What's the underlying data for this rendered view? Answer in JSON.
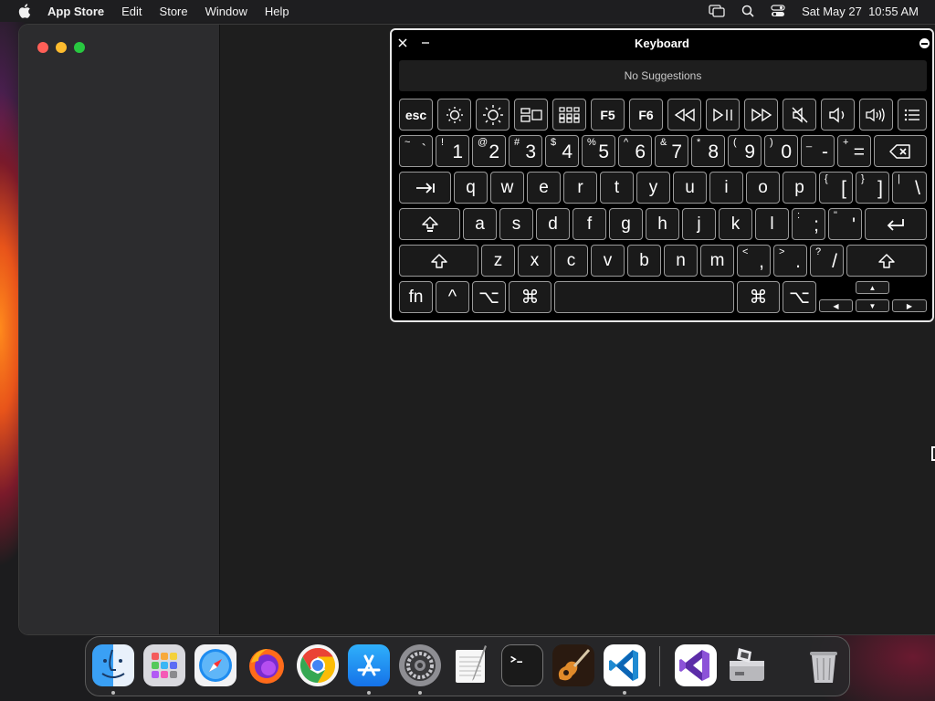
{
  "menubar": {
    "app_name": "App Store",
    "items": [
      "Edit",
      "Store",
      "Window",
      "Help"
    ],
    "datetime": "Sat May 27  10:55 AM"
  },
  "keyboard_viewer": {
    "title": "Keyboard",
    "suggestions": "No Suggestions",
    "function_row": [
      "esc",
      "brightness-down-icon",
      "brightness-up-icon",
      "mission-control-icon",
      "launchpad-icon",
      "F5",
      "F6",
      "rewind-icon",
      "play-pause-icon",
      "fast-forward-icon",
      "mute-icon",
      "volume-down-icon",
      "volume-up-icon",
      "menu-icon"
    ],
    "number_row": [
      {
        "shift": "~",
        "main": "`"
      },
      {
        "shift": "!",
        "main": "1"
      },
      {
        "shift": "@",
        "main": "2"
      },
      {
        "shift": "#",
        "main": "3"
      },
      {
        "shift": "$",
        "main": "4"
      },
      {
        "shift": "%",
        "main": "5"
      },
      {
        "shift": "^",
        "main": "6"
      },
      {
        "shift": "&",
        "main": "7"
      },
      {
        "shift": "*",
        "main": "8"
      },
      {
        "shift": "(",
        "main": "9"
      },
      {
        "shift": ")",
        "main": "0"
      },
      {
        "shift": "_",
        "main": "-"
      },
      {
        "shift": "+",
        "main": "="
      }
    ],
    "top_row": [
      "q",
      "w",
      "e",
      "r",
      "t",
      "y",
      "u",
      "i",
      "o",
      "p"
    ],
    "top_row_symbols": [
      {
        "shift": "{",
        "main": "["
      },
      {
        "shift": "}",
        "main": "]"
      },
      {
        "shift": "|",
        "main": "\\"
      }
    ],
    "home_row": [
      "a",
      "s",
      "d",
      "f",
      "g",
      "h",
      "j",
      "k",
      "l"
    ],
    "home_row_symbols": [
      {
        "shift": ":",
        "main": ";"
      },
      {
        "shift": "\"",
        "main": "'"
      }
    ],
    "bottom_row": [
      "z",
      "x",
      "c",
      "v",
      "b",
      "n",
      "m"
    ],
    "bottom_row_symbols": [
      {
        "shift": "<",
        "main": ","
      },
      {
        "shift": ">",
        "main": "."
      },
      {
        "shift": "?",
        "main": "/"
      }
    ],
    "modifier_row": {
      "fn": "fn",
      "control": "^",
      "option": "⌥",
      "command": "⌘"
    }
  },
  "dock": {
    "apps": [
      "Finder",
      "Launchpad",
      "Safari",
      "Firefox",
      "Google Chrome",
      "App Store",
      "System Settings",
      "TextEdit",
      "Terminal",
      "GarageBand",
      "Visual Studio Code",
      "Visual Studio",
      "Boot Camp Assistant",
      "Trash"
    ]
  }
}
